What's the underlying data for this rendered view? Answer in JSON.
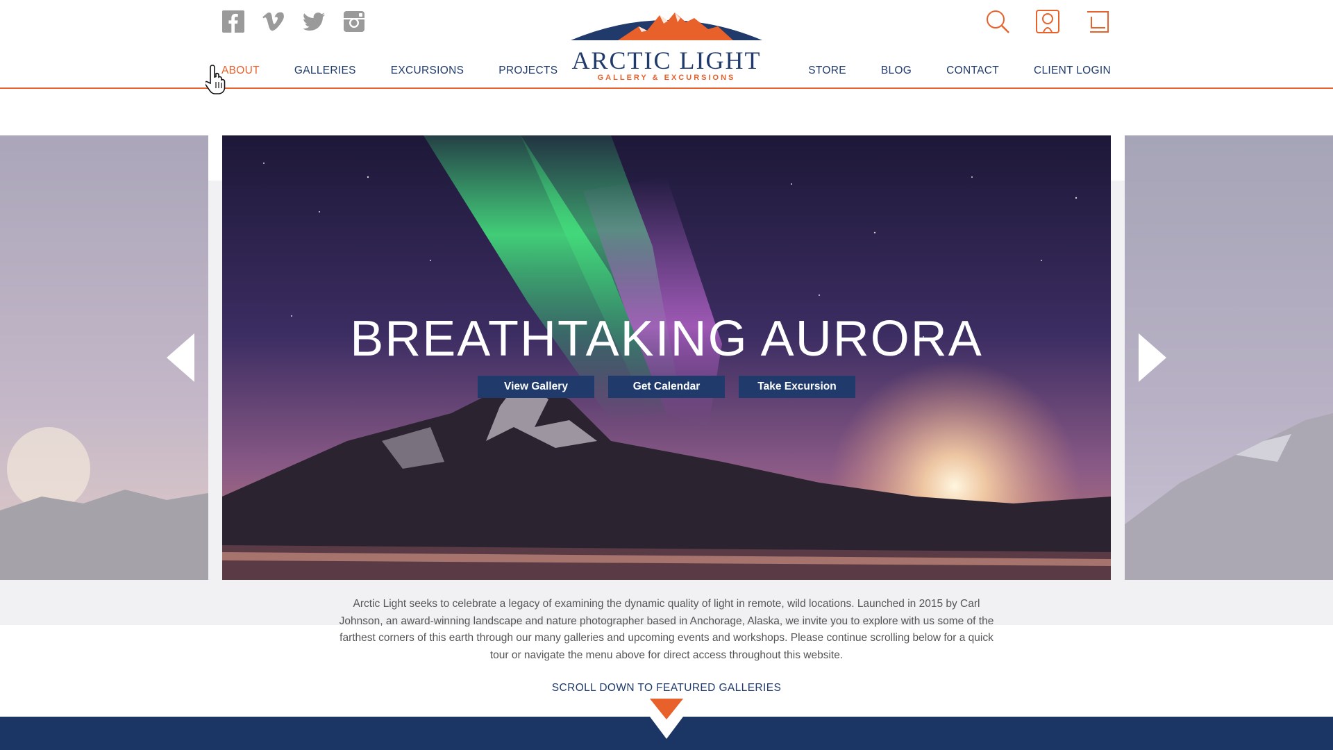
{
  "header": {
    "social": [
      {
        "icon": "facebook-icon"
      },
      {
        "icon": "vimeo-icon"
      },
      {
        "icon": "twitter-icon"
      },
      {
        "icon": "instagram-icon"
      }
    ],
    "utility": [
      {
        "icon": "search-icon"
      },
      {
        "icon": "account-icon"
      },
      {
        "icon": "cart-icon"
      }
    ],
    "logo": {
      "title": "ARCTIC LIGHT",
      "subtitle": "GALLERY & EXCURSIONS"
    },
    "nav_left": [
      "ABOUT",
      "GALLERIES",
      "EXCURSIONS",
      "PROJECTS"
    ],
    "nav_right": [
      "STORE",
      "BLOG",
      "CONTACT",
      "CLIENT LOGIN"
    ],
    "active_nav": "ABOUT"
  },
  "hero": {
    "title": "BREATHTAKING AURORA",
    "buttons": [
      "View Gallery",
      "Get Calendar",
      "Take Excursion"
    ]
  },
  "intro": {
    "text": "Arctic Light seeks to celebrate a legacy of examining the dynamic quality of light in remote, wild locations. Launched in 2015 by Carl Johnson, an award-winning landscape and nature photographer based in Anchorage, Alaska, we invite you to explore with us some of the farthest corners of this earth through our many galleries and upcoming events and workshops. Please continue scrolling below for a quick tour or navigate the menu above for direct access throughout this website."
  },
  "scroll": {
    "label": "SCROLL DOWN TO FEATURED GALLERIES"
  },
  "colors": {
    "navy": "#1f3a6b",
    "orange": "#e8602a",
    "icon_gray": "#9a9a9a",
    "band": "#1b3565"
  }
}
